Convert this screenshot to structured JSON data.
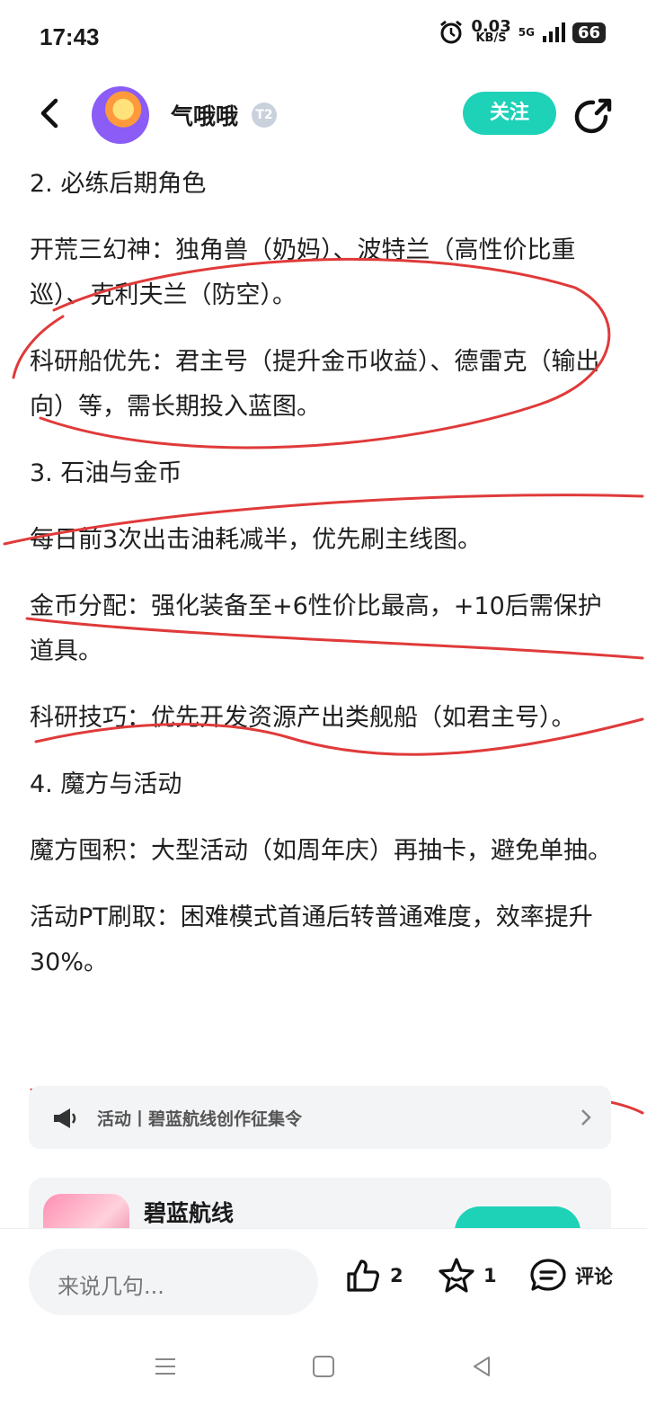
{
  "status_bar": {
    "time": "17:43",
    "net_speed": "0.03",
    "net_unit": "KB/S",
    "signal": "5G",
    "battery": "66"
  },
  "header": {
    "author": "气哦哦",
    "badge": "T2",
    "follow_label": "关注"
  },
  "content": {
    "s2_title": "2. 必练后期角色",
    "s2_p1": "开荒三幻神：独角兽（奶妈）、波特兰（高性价比重巡）、克利夫兰（防空）。",
    "s2_p2": "科研船优先：君主号（提升金币收益）、德雷克（输出向）等，需长期投入蓝图。",
    "s3_title": "3. 石油与金币",
    "s3_p1": "每日前3次出击油耗减半，优先刷主线图。",
    "s3_p2": "金币分配：强化装备至+6性价比最高，+10后需保护道具。",
    "s3_p3": "科研技巧：优先开发资源产出类舰船（如君主号）。",
    "s4_title": "4. 魔方与活动",
    "s4_p1": "魔方囤积：大型活动（如周年庆）再抽卡，避免单抽。",
    "s4_p2": "活动PT刷取：困难模式首通后转普通难度，效率提升30%。"
  },
  "activity": {
    "label": "活动丨碧蓝航线创作征集令"
  },
  "game_card": {
    "name": "碧蓝航线"
  },
  "bottom_bar": {
    "input_placeholder": "来说几句...",
    "like_count": "2",
    "fav_count": "1",
    "comment_label": "评论"
  },
  "colors": {
    "accent": "#1ed2b8",
    "annotation_red": "#e03a3a"
  }
}
